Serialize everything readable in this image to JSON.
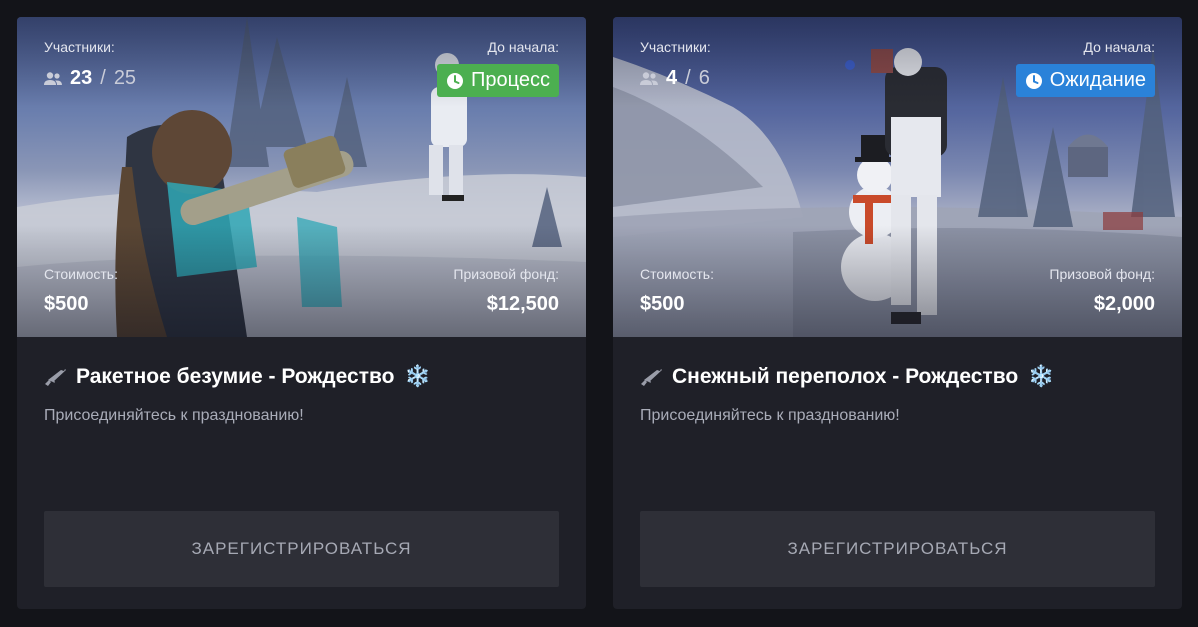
{
  "events": [
    {
      "participants_label": "Участники:",
      "participants_current": "23",
      "participants_separator": "/",
      "participants_max": "25",
      "start_label": "До начала:",
      "status": "Процесс",
      "status_color": "#4caf50",
      "cost_label": "Стоимость:",
      "cost": "$500",
      "prize_label": "Призовой фонд:",
      "prize": "$12,500",
      "title": "Ракетное безумие - Рождество",
      "title_emoji": "❄️",
      "description": "Присоединяйтесь к празднованию!",
      "button_label": "ЗАРЕГИСТРИРОВАТЬСЯ"
    },
    {
      "participants_label": "Участники:",
      "participants_current": "4",
      "participants_separator": "/",
      "participants_max": "6",
      "start_label": "До начала:",
      "status": "Ожидание",
      "status_color": "#2a82d9",
      "cost_label": "Стоимость:",
      "cost": "$500",
      "prize_label": "Призовой фонд:",
      "prize": "$2,000",
      "title": "Снежный переполох - Рождество",
      "title_emoji": "❄️",
      "description": "Присоединяйтесь к празднованию!",
      "button_label": "ЗАРЕГИСТРИРОВАТЬСЯ"
    }
  ]
}
